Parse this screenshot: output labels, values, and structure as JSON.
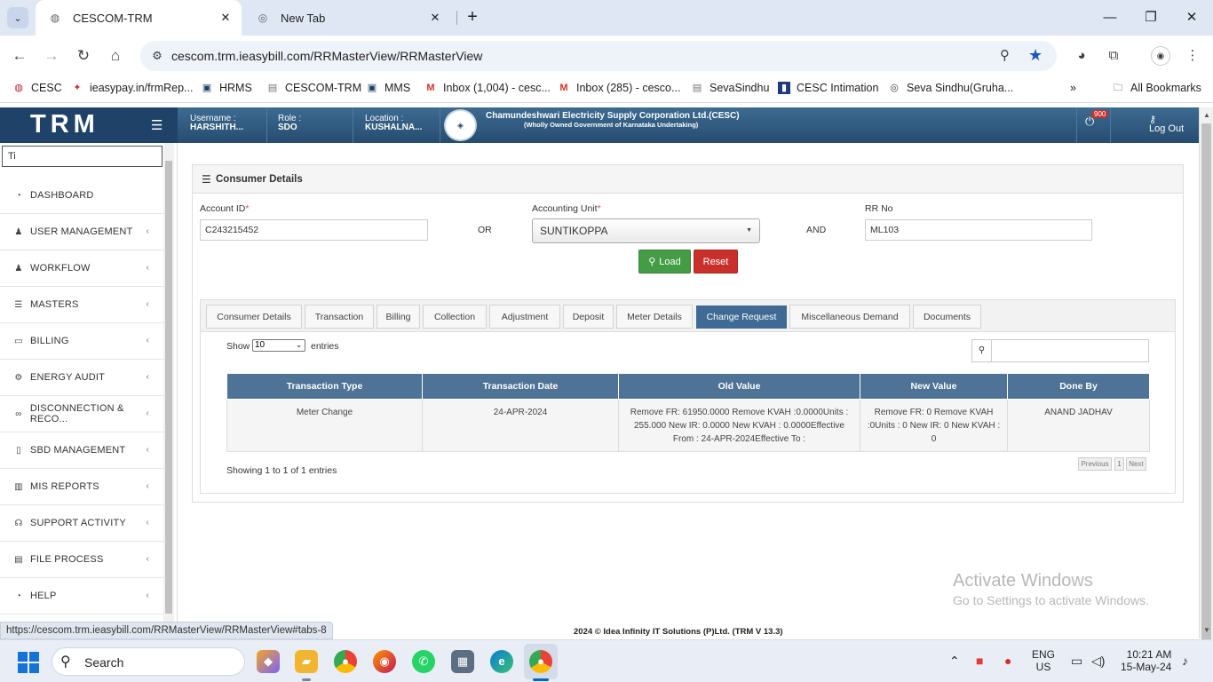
{
  "browser": {
    "tabs": [
      {
        "title": "CESCOM-TRM",
        "active": true
      },
      {
        "title": "New Tab",
        "active": false
      }
    ],
    "url": "cescom.trm.ieasybill.com/RRMasterView/RRMasterView",
    "bookmarks": [
      {
        "label": "CESC"
      },
      {
        "label": "ieasypay.in/frmRep..."
      },
      {
        "label": "HRMS"
      },
      {
        "label": "CESCOM-TRM"
      },
      {
        "label": "MMS"
      },
      {
        "label": "Inbox (1,004) - cesc..."
      },
      {
        "label": "Inbox (285) - cesco..."
      },
      {
        "label": "SevaSindhu"
      },
      {
        "label": "CESC Intimation"
      },
      {
        "label": "Seva Sindhu(Gruha..."
      }
    ],
    "all_bookmarks": "All Bookmarks",
    "status_url": "https://cescom.trm.ieasybill.com/RRMasterView/RRMasterView#tabs-8"
  },
  "header": {
    "logo": "TRM",
    "username_label": "Username :",
    "username": "HARSHITH...",
    "role_label": "Role :",
    "role": "SDO",
    "location_label": "Location :",
    "location": "KUSHALNA...",
    "corp_name": "Chamundeshwari Electricity Supply Corporation Ltd.(CESC)",
    "corp_sub": "(Wholly Owned Government of Karnataka Undertaking)",
    "notif_count": "900",
    "logout": "Log Out"
  },
  "sidebar": {
    "search_value": "Ti",
    "items": [
      {
        "label": "DASHBOARD",
        "icon": "dashboard-icon",
        "has_children": false
      },
      {
        "label": "USER MANAGEMENT",
        "icon": "user-icon",
        "has_children": true
      },
      {
        "label": "WORKFLOW",
        "icon": "user-icon",
        "has_children": true
      },
      {
        "label": "MASTERS",
        "icon": "list-icon",
        "has_children": true
      },
      {
        "label": "BILLING",
        "icon": "monitor-icon",
        "has_children": true
      },
      {
        "label": "ENERGY AUDIT",
        "icon": "cogs-icon",
        "has_children": true
      },
      {
        "label": "DISCONNECTION & RECO...",
        "icon": "link-icon",
        "has_children": true
      },
      {
        "label": "SBD MANAGEMENT",
        "icon": "mobile-icon",
        "has_children": true
      },
      {
        "label": "MIS REPORTS",
        "icon": "bar-chart-icon",
        "has_children": true
      },
      {
        "label": "SUPPORT ACTIVITY",
        "icon": "headset-icon",
        "has_children": true
      },
      {
        "label": "FILE PROCESS",
        "icon": "file-icon",
        "has_children": true
      },
      {
        "label": "HELP",
        "icon": "dashboard-icon",
        "has_children": true
      }
    ]
  },
  "consumer": {
    "title": "Consumer Details",
    "account_id_label": "Account ID",
    "account_id_value": "C243215452",
    "or_label": "OR",
    "accounting_unit_label": "Accounting Unit",
    "accounting_unit_value": "SUNTIKOPPA",
    "and_label": "AND",
    "rr_no_label": "RR No",
    "rr_no_value": "ML103",
    "load_label": "Load",
    "reset_label": "Reset",
    "required_mark": "*"
  },
  "tabs": [
    {
      "label": "Consumer Details",
      "active": false
    },
    {
      "label": "Transaction",
      "active": false
    },
    {
      "label": "Billing",
      "active": false
    },
    {
      "label": "Collection",
      "active": false
    },
    {
      "label": "Adjustment",
      "active": false
    },
    {
      "label": "Deposit",
      "active": false
    },
    {
      "label": "Meter Details",
      "active": false
    },
    {
      "label": "Change Request",
      "active": true
    },
    {
      "label": "Miscellaneous Demand",
      "active": false
    },
    {
      "label": "Documents",
      "active": false
    }
  ],
  "table": {
    "show_label": "Show",
    "entries_value": "10",
    "entries_label": "entries",
    "columns": [
      "Transaction Type",
      "Transaction Date",
      "Old Value",
      "New Value",
      "Done By"
    ],
    "rows": [
      [
        "Meter Change",
        "24-APR-2024",
        "Remove FR: 61950.0000 Remove KVAH :0.0000Units : 255.000 New IR: 0.0000 New KVAH : 0.0000Effective From : 24-APR-2024Effective To :",
        "Remove FR: 0 Remove KVAH :0Units : 0 New IR: 0 New KVAH : 0",
        "ANAND JADHAV"
      ]
    ],
    "info": "Showing 1 to 1 of 1 entries",
    "pager": {
      "previous": "Previous",
      "page": "1",
      "next": "Next"
    }
  },
  "footer": "2024 © Idea Infinity IT Solutions (P)Ltd. (TRM V 13.3)",
  "watermark": {
    "line1": "Activate Windows",
    "line2": "Go to Settings to activate Windows."
  },
  "taskbar": {
    "search_label": "Search",
    "lang_line1": "ENG",
    "lang_line2": "US",
    "time": "10:21 AM",
    "date": "15-May-24"
  },
  "colors": {
    "header_blue": "#264c70",
    "active_tab": "#3e6a93",
    "table_head": "#4e7397",
    "load_green": "#449d44",
    "reset_red": "#c9302c"
  }
}
